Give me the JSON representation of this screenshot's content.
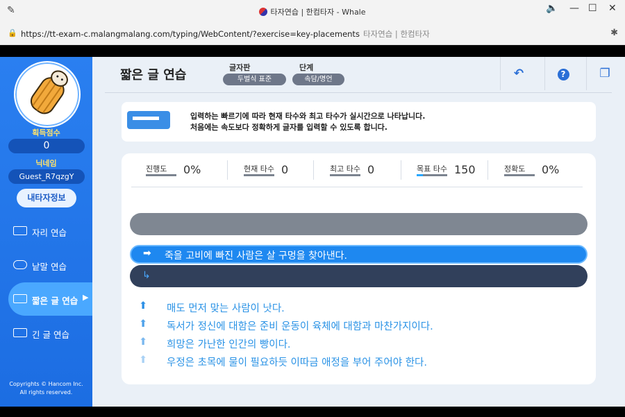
{
  "browser": {
    "window_title": "타자연습 | 한컴타자 - Whale",
    "url": "https://tt-exam-c.malangmalang.com/typing/WebContent/?exercise=key-placements",
    "url_subtitle": "타자연습 | 한컴타자"
  },
  "sidebar": {
    "score_label": "획득점수",
    "score_value": "0",
    "nickname_label": "닉네임",
    "nickname_value": "Guest_R7qzgY",
    "my_info_button": "내타자정보",
    "nav": [
      {
        "label": "자리 연습",
        "icon": "keyboard-icon"
      },
      {
        "label": "낱말 연습",
        "icon": "speech-bubble-icon"
      },
      {
        "label": "짧은 글 연습",
        "icon": "short-text-icon",
        "active": true
      },
      {
        "label": "긴 글 연습",
        "icon": "long-text-icon"
      }
    ],
    "copyright_line1": "Copyrights © Hancom Inc.",
    "copyright_line2": "All rights reserved."
  },
  "header": {
    "title": "짧은 글 연습",
    "keyboard_label": "글자판",
    "keyboard_value": "두벌식 표준",
    "level_label": "단계",
    "level_value": "속담/명언"
  },
  "info": {
    "line1": "입력하는 빠르기에 따라 현재 타수와 최고 타수가 실시간으로 나타납니다.",
    "line2": "처음에는 속도보다 정확하게 글자를 입력할 수 있도록 합니다."
  },
  "stats": {
    "progress": {
      "label": "진행도",
      "value": "0%"
    },
    "current_speed": {
      "label": "현재 타수",
      "value": "0"
    },
    "best_speed": {
      "label": "최고 타수",
      "value": "0"
    },
    "target_speed": {
      "label": "목표 타수",
      "value": "150",
      "fill_fraction": 0.2
    },
    "accuracy": {
      "label": "정확도",
      "value": "0%"
    }
  },
  "typing": {
    "current_sentence": "죽을 고비에 빠진 사람은 살 구멍을 찾아낸다.",
    "input_value": ""
  },
  "upcoming": [
    "매도 먼저 맞는 사람이 낫다.",
    "독서가 정신에 대함은 준비 운동이 육체에 대함과 마찬가지이다.",
    "희망은 가난한 인간의 빵이다.",
    "우정은 초목에 물이 필요하듯 이따금 애정을 부어 주어야 한다."
  ],
  "colors": {
    "sidebar_blue": "#2a7ff0",
    "current_line_blue": "#1e88f0",
    "input_navy": "#31405b",
    "preview_gray": "#7f8792"
  }
}
